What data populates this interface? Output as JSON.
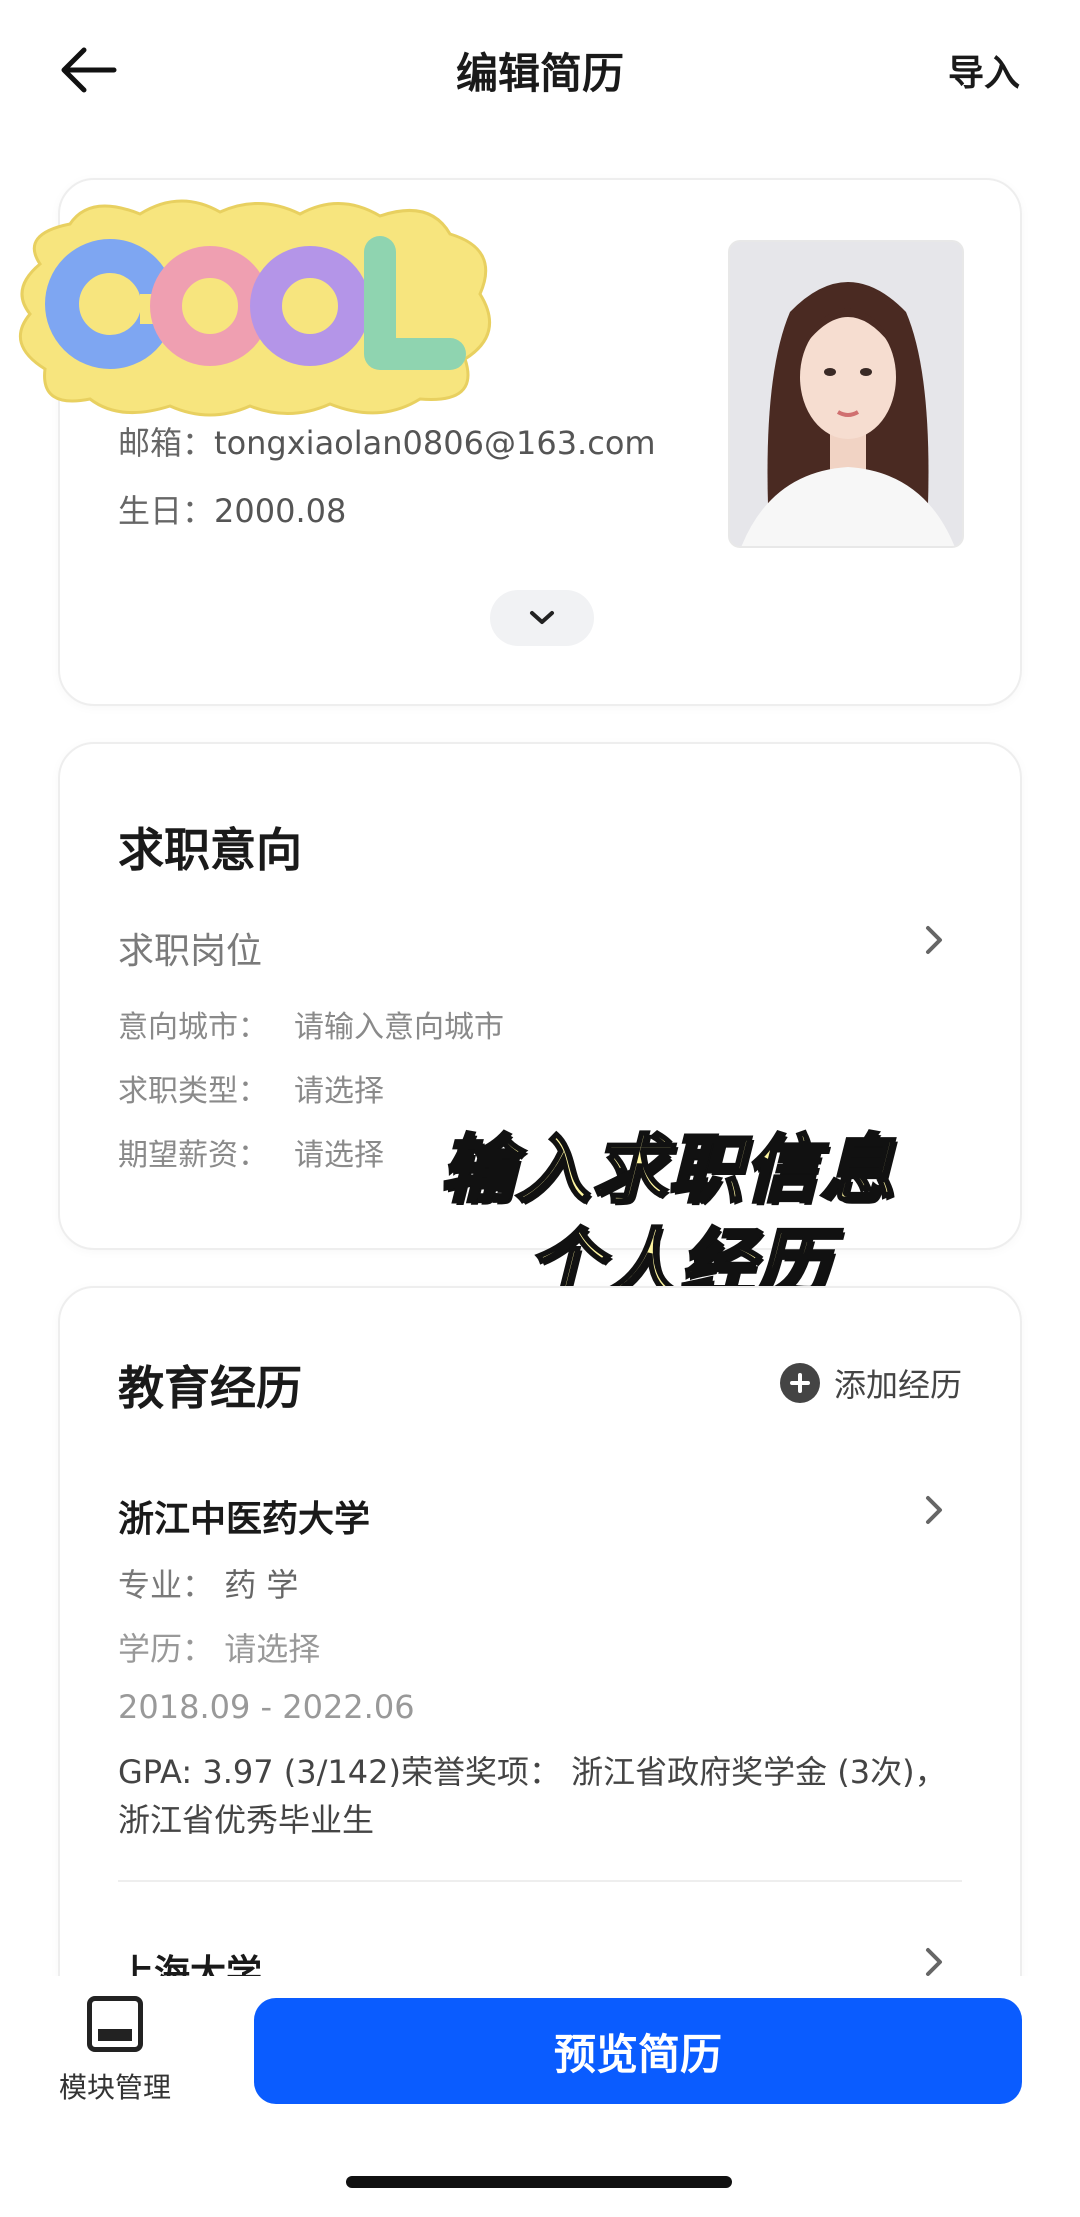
{
  "header": {
    "title": "编辑简历",
    "import_label": "导入"
  },
  "profile": {
    "sticker_text": "COOL",
    "email_label": "邮箱：",
    "email": "tongxiaolan0806@163.com",
    "birthday_label": "生日：",
    "birthday": "2000.08"
  },
  "intent": {
    "title": "求职意向",
    "position_label": "求职岗位",
    "city_label": "意向城市：",
    "city_value": "请输入意向城市",
    "type_label": "求职类型：",
    "type_value": "请选择",
    "salary_label": "期望薪资：",
    "salary_value": "请选择"
  },
  "overlay": {
    "line1": "输入求职信息",
    "line2": "个人经历"
  },
  "education": {
    "title": "教育经历",
    "add_label": "添加经历",
    "items": [
      {
        "school": "浙江中医药大学",
        "major_label": "专业：",
        "major": "药 学",
        "degree_label": "学历：",
        "degree": "请选择",
        "period": "2018.09 - 2022.06",
        "gpa": "GPA: 3.97 (3/142)荣誉奖项： 浙江省政府奖学金 (3次)，浙江省优秀毕业生"
      },
      {
        "school": "上海大学"
      }
    ]
  },
  "bottom": {
    "module_label": "模块管理",
    "preview_label": "预览简历"
  },
  "colors": {
    "primary": "#0a5cff",
    "overlay_fill": "#fff6a0"
  }
}
